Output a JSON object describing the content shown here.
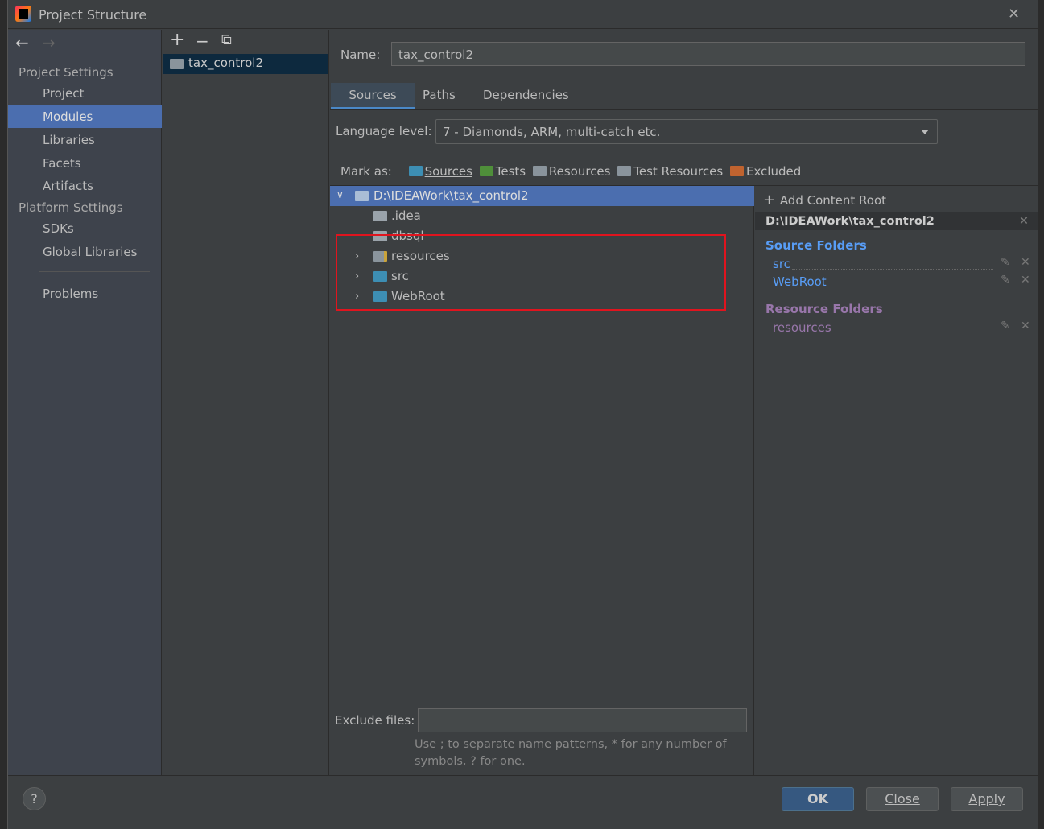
{
  "window": {
    "title": "Project Structure",
    "close": "✕"
  },
  "nav": {
    "back": "←",
    "forward": "→",
    "items": [
      {
        "label": "Project Settings",
        "type": "header"
      },
      {
        "label": "Project"
      },
      {
        "label": "Modules",
        "selected": true
      },
      {
        "label": "Libraries"
      },
      {
        "label": "Facets"
      },
      {
        "label": "Artifacts"
      },
      {
        "label": "Platform Settings",
        "type": "header"
      },
      {
        "label": "SDKs"
      },
      {
        "label": "Global Libraries"
      },
      {
        "label": "Problems"
      }
    ]
  },
  "modules": {
    "add": "+",
    "remove": "−",
    "copy": "⧉",
    "items": [
      "tax_control2"
    ]
  },
  "name": {
    "label": "Name:",
    "value": "tax_control2"
  },
  "tabs": [
    "Sources",
    "Paths",
    "Dependencies"
  ],
  "language": {
    "label": "Language level:",
    "value": "7 - Diamonds, ARM, multi-catch etc."
  },
  "mark_as": {
    "label": "Mark as:",
    "items": [
      {
        "label": "Sources",
        "color": "#3d8eb3"
      },
      {
        "label": "Tests",
        "color": "#4f8f3a"
      },
      {
        "label": "Resources",
        "color": "#8a949c"
      },
      {
        "label": "Test Resources",
        "color": "#8a949c"
      },
      {
        "label": "Excluded",
        "color": "#c0632f"
      }
    ]
  },
  "tree": {
    "root": "D:\\IDEAWork\\tax_control2",
    "children": [
      {
        "label": ".idea",
        "expandable": false,
        "color": "#9aa3aa"
      },
      {
        "label": "dbsql",
        "expandable": false,
        "color": "#9aa3aa"
      },
      {
        "label": "resources",
        "expandable": true,
        "color": "#8a949c"
      },
      {
        "label": "src",
        "expandable": true,
        "color": "#3d8eb3"
      },
      {
        "label": "WebRoot",
        "expandable": true,
        "color": "#3d8eb3"
      }
    ]
  },
  "content_root": {
    "add_label": "Add Content Root",
    "path": "D:\\IDEAWork\\tax_control2",
    "source_title": "Source Folders",
    "sources": [
      "src",
      "WebRoot"
    ],
    "resource_title": "Resource Folders",
    "resources": [
      "resources"
    ]
  },
  "exclude": {
    "label": "Exclude files:",
    "value": "",
    "hint1": "Use ; to separate name patterns, * for any number of",
    "hint2": "symbols, ? for one."
  },
  "footer": {
    "help": "?",
    "ok": "OK",
    "close": "Close",
    "apply": "Apply"
  },
  "colors": {
    "selection": "#4b6eaf",
    "highlight_box": "#e0141e",
    "source_blue": "#589df6",
    "resource_purple": "#9876aa"
  }
}
